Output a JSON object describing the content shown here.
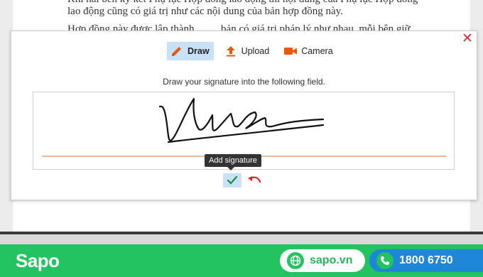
{
  "document": {
    "lines": [
      "Khi hai bên ký kết Phụ lục Hợp đồng lao động thì nội dung của Phụ lục Hợp đồng",
      "lao động cũng có giá trị như các nội dung của bản hợp đồng này.",
      "Hợp đồng này được lập thành ........ bản có giá trị pháp lý như nhau, mỗi bên giữ"
    ]
  },
  "dialog": {
    "tabs": [
      {
        "label": "Draw",
        "icon": "pencil-icon",
        "active": true
      },
      {
        "label": "Upload",
        "icon": "upload-icon",
        "active": false
      },
      {
        "label": "Camera",
        "icon": "camera-icon",
        "active": false
      }
    ],
    "instruction": "Draw your signature into the following field.",
    "tooltip": "Add signature",
    "colors": {
      "accent": "#e8590c",
      "active_tab": "#c8e0f8",
      "close": "#e0242b"
    }
  },
  "footer": {
    "brand": "Sapo",
    "website": "sapo.vn",
    "hotline": "1800 6750",
    "colors": {
      "background": "#23c35f",
      "phone_pill": "#1f87d8"
    }
  }
}
